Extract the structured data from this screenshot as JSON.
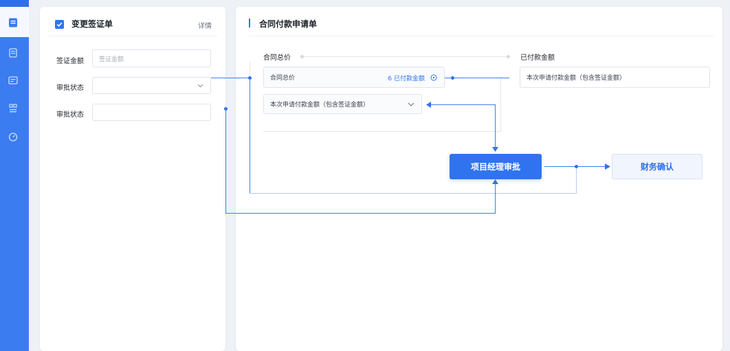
{
  "left_panel": {
    "title": "变更签证单",
    "detail_link": "详情",
    "fields": [
      {
        "label": "签证金额",
        "placeholder": "签证金额"
      },
      {
        "label": "审批状态",
        "value": ""
      },
      {
        "label": "审批状态",
        "value": ""
      }
    ]
  },
  "right_panel": {
    "title": "合同付款申请单",
    "total_header": "合同总价",
    "paid_header": "已付款金额",
    "total_field_label": "合同总价",
    "paid_indicator": "6 已付款金额",
    "amount_select": "本次申请付款金额（包含签证金额）",
    "amount_field_right": "本次申请付款金额（包含签证金额）",
    "flow": {
      "primary_step": "项目经理审批",
      "secondary_step": "财务确认"
    }
  },
  "colors": {
    "accent": "#2f74ee",
    "rail": "#3b7cf0",
    "background": "#eef1f6"
  }
}
